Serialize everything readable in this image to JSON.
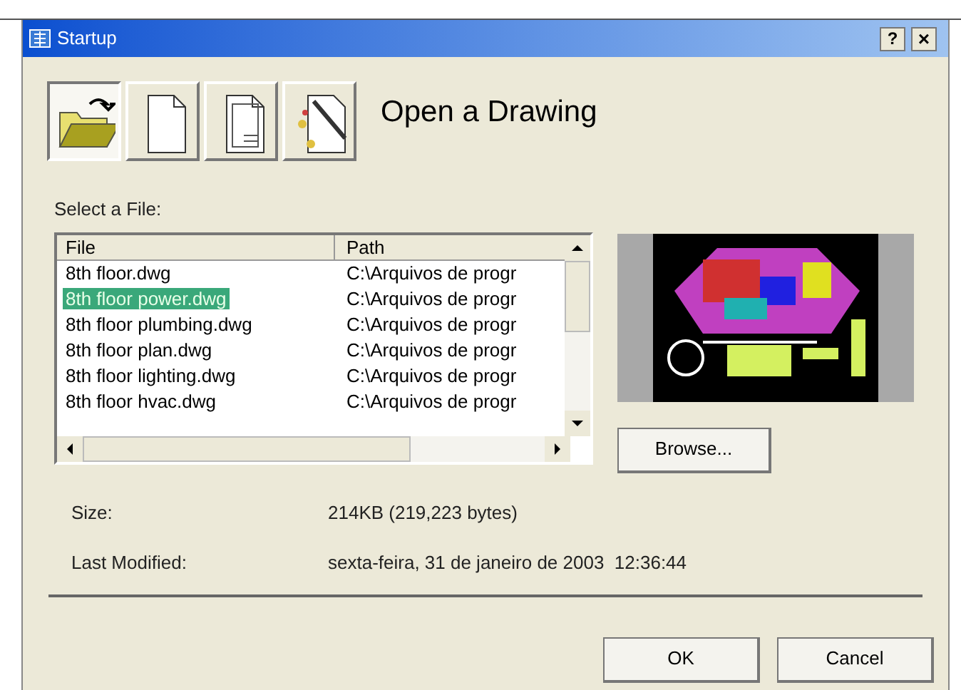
{
  "window": {
    "title": "Startup",
    "help_button": "?",
    "close_button": "×"
  },
  "toolbar": [
    {
      "kind": "open",
      "selected": true
    },
    {
      "kind": "blank",
      "selected": false
    },
    {
      "kind": "template",
      "selected": false
    },
    {
      "kind": "wizard",
      "selected": false
    }
  ],
  "heading": "Open a Drawing",
  "file_label": "Select a File:",
  "table": {
    "columns": [
      "File",
      "Path"
    ],
    "rows": [
      {
        "file": "8th floor.dwg",
        "path": "C:\\Arquivos de progr",
        "selected": false
      },
      {
        "file": "8th floor power.dwg",
        "path": "C:\\Arquivos de progr",
        "selected": true
      },
      {
        "file": "8th floor plumbing.dwg",
        "path": "C:\\Arquivos de progr",
        "selected": false
      },
      {
        "file": "8th floor plan.dwg",
        "path": "C:\\Arquivos de progr",
        "selected": false
      },
      {
        "file": "8th floor lighting.dwg",
        "path": "C:\\Arquivos de progr",
        "selected": false
      },
      {
        "file": "8th floor hvac.dwg",
        "path": "C:\\Arquivos de progr",
        "selected": false
      }
    ]
  },
  "browse_button": "Browse...",
  "details": [
    {
      "label": "Size:",
      "value": "214KB (219,223 bytes)"
    },
    {
      "label": "Last Modified:",
      "value": "sexta-feira, 31 de janeiro de 2003  12:36:44"
    }
  ],
  "buttons": [
    "OK",
    "Cancel"
  ]
}
